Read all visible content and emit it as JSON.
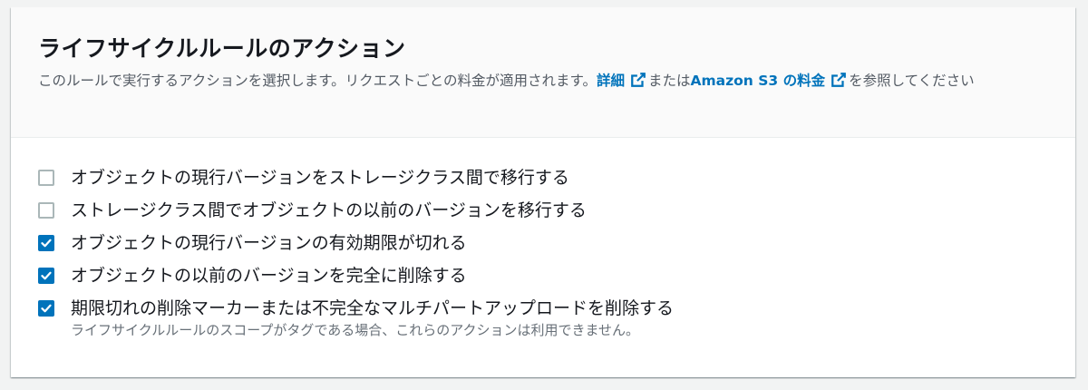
{
  "panel": {
    "title": "ライフサイクルルールのアクション",
    "description_prefix": "このルールで実行するアクションを選択します。リクエストごとの料金が適用されます。",
    "details_link": "詳細",
    "or_text": "または",
    "pricing_link": "Amazon S3 の料金",
    "description_suffix": "を参照してください"
  },
  "options": [
    {
      "label": "オブジェクトの現行バージョンをストレージクラス間で移行する",
      "checked": false
    },
    {
      "label": "ストレージクラス間でオブジェクトの以前のバージョンを移行する",
      "checked": false
    },
    {
      "label": "オブジェクトの現行バージョンの有効期限が切れる",
      "checked": true
    },
    {
      "label": "オブジェクトの以前のバージョンを完全に削除する",
      "checked": true
    },
    {
      "label": "期限切れの削除マーカーまたは不完全なマルチパートアップロードを削除する",
      "checked": true,
      "help": "ライフサイクルルールのスコープがタグである場合、これらのアクションは利用できません。"
    }
  ],
  "colors": {
    "link": "#0073bb",
    "checkbox_checked": "#0073bb",
    "checkbox_border": "#aab7b8",
    "title": "#16191f",
    "secondary_text": "#545b64"
  },
  "icons": {
    "external_link": "external-link-icon",
    "check": "check-icon"
  }
}
